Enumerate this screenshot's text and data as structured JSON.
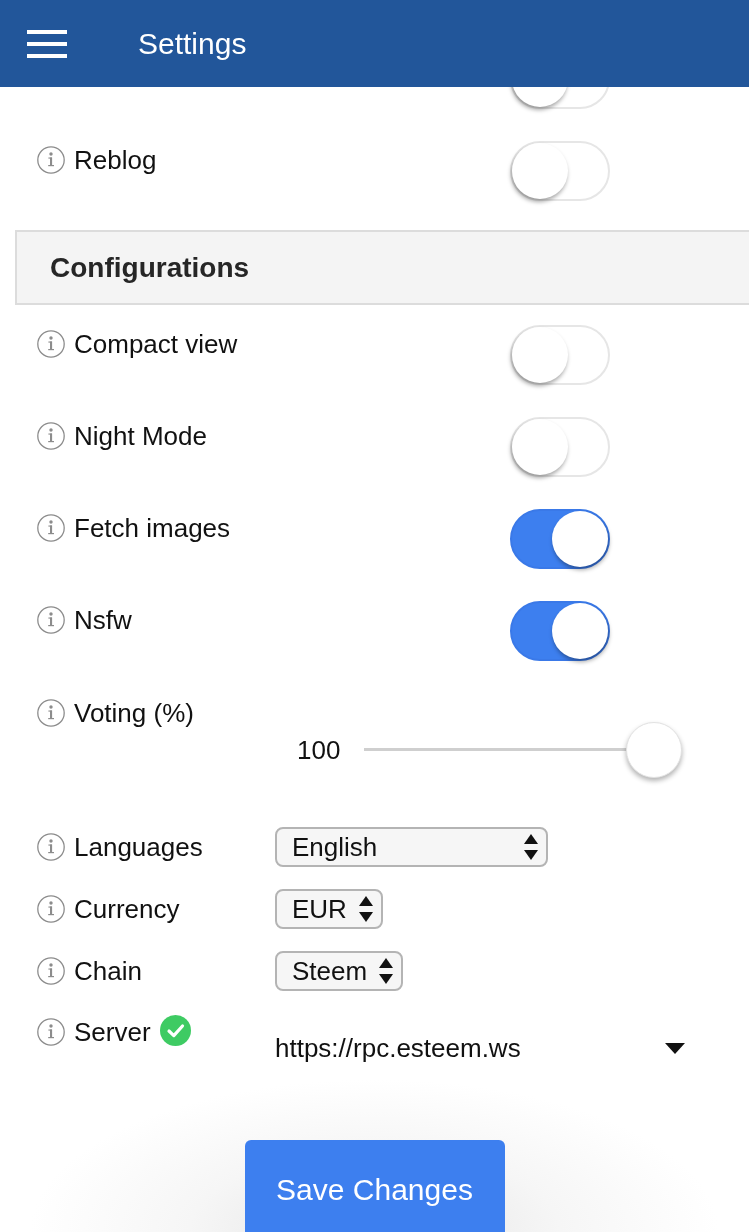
{
  "header": {
    "title": "Settings"
  },
  "sections": [
    {
      "items": [
        {
          "kind": "toggle",
          "on": false
        },
        {
          "kind": "toggle",
          "label": "Reblog",
          "on": false
        }
      ]
    },
    {
      "title": "Configurations",
      "items": [
        {
          "kind": "toggle",
          "label": "Compact view",
          "on": false
        },
        {
          "kind": "toggle",
          "label": "Night Mode",
          "on": false
        },
        {
          "kind": "toggle",
          "label": "Fetch images",
          "on": true
        },
        {
          "kind": "toggle",
          "label": "Nsfw",
          "on": true
        },
        {
          "kind": "slider",
          "label": "Voting (%)",
          "reading": "100",
          "level": 1
        },
        {
          "kind": "select",
          "label": "Languages",
          "value": "English"
        },
        {
          "kind": "select",
          "label": "Currency",
          "value": "EUR"
        },
        {
          "kind": "select",
          "label": "Chain",
          "value": "Steem"
        },
        {
          "kind": "dropdown",
          "label": "Server",
          "value": "https://rpc.esteem.ws",
          "verified": true
        }
      ]
    }
  ],
  "save_button": {
    "label": "Save Changes"
  }
}
